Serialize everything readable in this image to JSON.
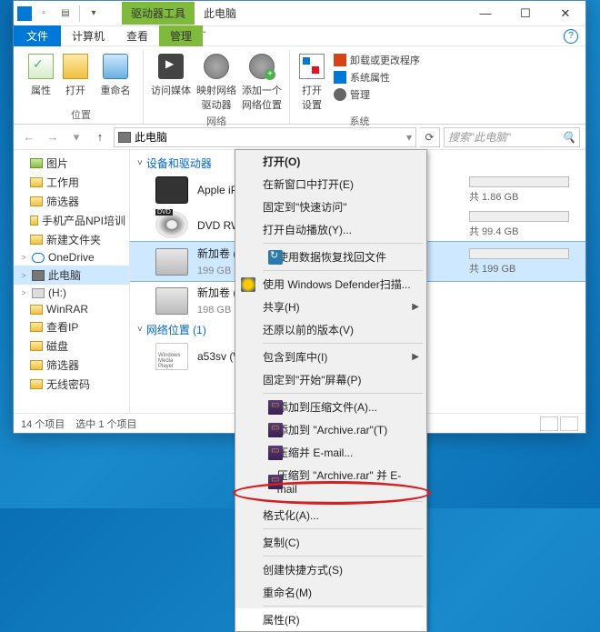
{
  "titlebar": {
    "tool_tab": "驱动器工具",
    "title_tab": "此电脑"
  },
  "menubar": {
    "file": "文件",
    "computer": "计算机",
    "view": "查看",
    "manage": "管理"
  },
  "ribbon": {
    "props": "属性",
    "open": "打开",
    "rename": "重命名",
    "group_location": "位置",
    "media": "访问媒体",
    "map_drive": "映射网络\n驱动器",
    "add_net": "添加一个\n网络位置",
    "group_network": "网络",
    "open_settings": "打开\n设置",
    "uninstall": "卸载或更改程序",
    "sys_props": "系统属性",
    "manage": "管理",
    "group_system": "系统"
  },
  "address": {
    "path": "此电脑",
    "dropdown_hint": "▾",
    "search_placeholder": "搜索\"此电脑\""
  },
  "sidebar": {
    "items": [
      {
        "label": "图片",
        "icon": "pic",
        "indent": 18
      },
      {
        "label": "工作用",
        "icon": "folder",
        "indent": 18
      },
      {
        "label": "筛选器",
        "icon": "folder",
        "indent": 18
      },
      {
        "label": "手机产品NPI培训",
        "icon": "folder",
        "indent": 18
      },
      {
        "label": "新建文件夹",
        "icon": "folder",
        "indent": 18
      },
      {
        "label": "OneDrive",
        "icon": "cloud",
        "indent": 6,
        "expander": ">"
      },
      {
        "label": "此电脑",
        "icon": "pc",
        "indent": 6,
        "expander": ">",
        "selected": true
      },
      {
        "label": "(H:)",
        "icon": "drive",
        "indent": 6,
        "expander": ">"
      },
      {
        "label": "WinRAR",
        "icon": "folder",
        "indent": 18
      },
      {
        "label": "查看IP",
        "icon": "folder",
        "indent": 18
      },
      {
        "label": "磁盘",
        "icon": "folder",
        "indent": 18
      },
      {
        "label": "筛选器",
        "icon": "folder",
        "indent": 18
      },
      {
        "label": "无线密码",
        "icon": "folder",
        "indent": 18
      }
    ]
  },
  "content": {
    "section_devices": "设备和驱动器",
    "section_network": "网络位置 (1)",
    "devices": [
      {
        "name": "Apple iPhone",
        "sub": "",
        "icon": "phone",
        "cap_text": "共 1.86 GB"
      },
      {
        "name": "DVD RW 驱动器",
        "sub": "",
        "icon": "dvd",
        "cap_text": "共 99.4 GB"
      },
      {
        "name": "新加卷 (D:)",
        "sub": "199 GB 可用",
        "icon": "hdd",
        "selected": true,
        "cap_text": "共 199 GB"
      },
      {
        "name": "新加卷 (E:)",
        "sub": "198 GB 可用",
        "icon": "hdd"
      }
    ],
    "network_items": [
      {
        "name": "a53sv (Windows Media Player)",
        "icon": "wmp"
      }
    ]
  },
  "context_menu": {
    "items": [
      {
        "label": "打开(O)",
        "bold": true
      },
      {
        "label": "在新窗口中打开(E)"
      },
      {
        "label": "固定到\"快速访问\""
      },
      {
        "label": "打开自动播放(Y)..."
      },
      {
        "sep": true
      },
      {
        "label": "使用数据恢复找回文件",
        "icon": "recover"
      },
      {
        "sep": true
      },
      {
        "label": "使用 Windows Defender扫描...",
        "icon": "shield"
      },
      {
        "label": "共享(H)",
        "arrow": true
      },
      {
        "label": "还原以前的版本(V)"
      },
      {
        "sep": true
      },
      {
        "label": "包含到库中(I)",
        "arrow": true
      },
      {
        "label": "固定到\"开始\"屏幕(P)"
      },
      {
        "sep": true
      },
      {
        "label": "添加到压缩文件(A)...",
        "icon": "rar"
      },
      {
        "label": "添加到 \"Archive.rar\"(T)",
        "icon": "rar"
      },
      {
        "label": "压缩并 E-mail...",
        "icon": "rar"
      },
      {
        "label": "压缩到 \"Archive.rar\" 并 E-mail",
        "icon": "rar"
      },
      {
        "sep": true
      },
      {
        "label": "格式化(A)..."
      },
      {
        "sep": true
      },
      {
        "label": "复制(C)"
      },
      {
        "sep": true
      },
      {
        "label": "创建快捷方式(S)"
      },
      {
        "label": "重命名(M)"
      },
      {
        "sep": true
      },
      {
        "label": "属性(R)",
        "highlighted": true
      }
    ]
  },
  "statusbar": {
    "count": "14 个项目",
    "selected": "选中 1 个项目"
  }
}
